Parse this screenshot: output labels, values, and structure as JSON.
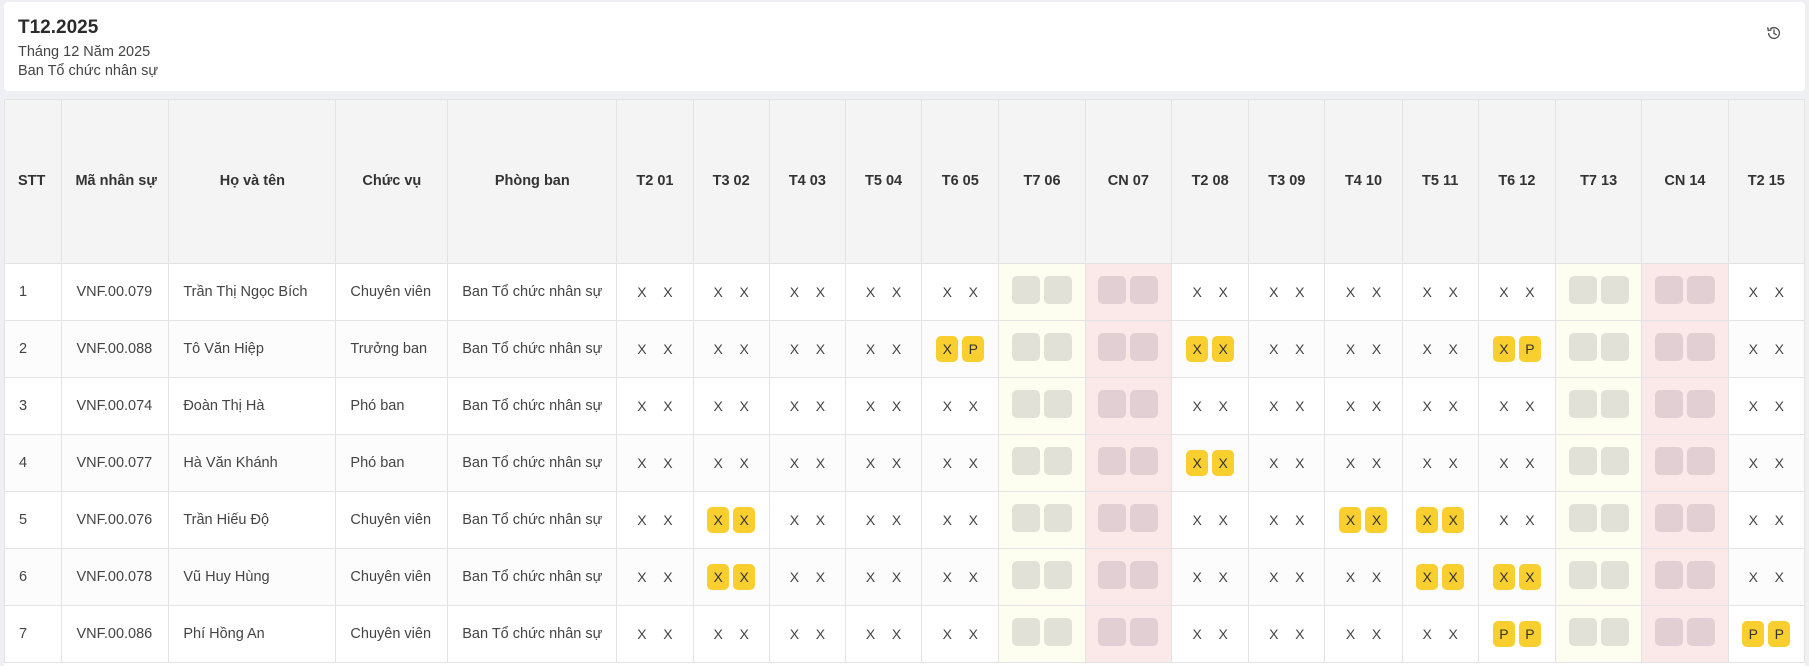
{
  "header": {
    "title": "T12.2025",
    "subtitle": "Tháng 12 Năm 2025",
    "department": "Ban Tổ chức nhân sự",
    "history_icon": "history-icon"
  },
  "columns": {
    "stt": "STT",
    "code": "Mã nhân sự",
    "name": "Họ và tên",
    "position": "Chức vụ",
    "dept": "Phòng ban",
    "days": [
      {
        "label": "T2 01",
        "type": "work"
      },
      {
        "label": "T3 02",
        "type": "work"
      },
      {
        "label": "T4 03",
        "type": "work"
      },
      {
        "label": "T5 04",
        "type": "work"
      },
      {
        "label": "T6 05",
        "type": "work"
      },
      {
        "label": "T7 06",
        "type": "sat"
      },
      {
        "label": "CN 07",
        "type": "sun"
      },
      {
        "label": "T2 08",
        "type": "work"
      },
      {
        "label": "T3 09",
        "type": "work"
      },
      {
        "label": "T4 10",
        "type": "work"
      },
      {
        "label": "T5 11",
        "type": "work"
      },
      {
        "label": "T6 12",
        "type": "work"
      },
      {
        "label": "T7 13",
        "type": "sat"
      },
      {
        "label": "CN 14",
        "type": "sun"
      },
      {
        "label": "T2 15",
        "type": "work"
      }
    ]
  },
  "rows": [
    {
      "stt": "1",
      "code": "VNF.00.079",
      "name": "Trần Thị Ngọc Bích",
      "position": "Chuyên viên",
      "dept": "Ban Tổ chức nhân sự",
      "days": [
        [
          "X",
          "X"
        ],
        [
          "X",
          "X"
        ],
        [
          "X",
          "X"
        ],
        [
          "X",
          "X"
        ],
        [
          "X",
          "X"
        ],
        [
          "",
          ""
        ],
        [
          "",
          ""
        ],
        [
          "X",
          "X"
        ],
        [
          "X",
          "X"
        ],
        [
          "X",
          "X"
        ],
        [
          "X",
          "X"
        ],
        [
          "X",
          "X"
        ],
        [
          "",
          ""
        ],
        [
          "",
          ""
        ],
        [
          "X",
          "X"
        ]
      ],
      "hl": []
    },
    {
      "stt": "2",
      "code": "VNF.00.088",
      "name": "Tô Văn Hiệp",
      "position": "Trưởng ban",
      "dept": "Ban Tổ chức nhân sự",
      "days": [
        [
          "X",
          "X"
        ],
        [
          "X",
          "X"
        ],
        [
          "X",
          "X"
        ],
        [
          "X",
          "X"
        ],
        [
          "X",
          "P"
        ],
        [
          "",
          ""
        ],
        [
          "",
          ""
        ],
        [
          "X",
          "X"
        ],
        [
          "X",
          "X"
        ],
        [
          "X",
          "X"
        ],
        [
          "X",
          "X"
        ],
        [
          "X",
          "P"
        ],
        [
          "",
          ""
        ],
        [
          "",
          ""
        ],
        [
          "X",
          "X"
        ]
      ],
      "hl": [
        4,
        7,
        11
      ]
    },
    {
      "stt": "3",
      "code": "VNF.00.074",
      "name": "Đoàn Thị Hà",
      "position": "Phó ban",
      "dept": "Ban Tổ chức nhân sự",
      "days": [
        [
          "X",
          "X"
        ],
        [
          "X",
          "X"
        ],
        [
          "X",
          "X"
        ],
        [
          "X",
          "X"
        ],
        [
          "X",
          "X"
        ],
        [
          "",
          ""
        ],
        [
          "",
          ""
        ],
        [
          "X",
          "X"
        ],
        [
          "X",
          "X"
        ],
        [
          "X",
          "X"
        ],
        [
          "X",
          "X"
        ],
        [
          "X",
          "X"
        ],
        [
          "",
          ""
        ],
        [
          "",
          ""
        ],
        [
          "X",
          "X"
        ]
      ],
      "hl": []
    },
    {
      "stt": "4",
      "code": "VNF.00.077",
      "name": "Hà Văn Khánh",
      "position": "Phó ban",
      "dept": "Ban Tổ chức nhân sự",
      "days": [
        [
          "X",
          "X"
        ],
        [
          "X",
          "X"
        ],
        [
          "X",
          "X"
        ],
        [
          "X",
          "X"
        ],
        [
          "X",
          "X"
        ],
        [
          "",
          ""
        ],
        [
          "",
          ""
        ],
        [
          "X",
          "X"
        ],
        [
          "X",
          "X"
        ],
        [
          "X",
          "X"
        ],
        [
          "X",
          "X"
        ],
        [
          "X",
          "X"
        ],
        [
          "",
          ""
        ],
        [
          "",
          ""
        ],
        [
          "X",
          "X"
        ]
      ],
      "hl": [
        7
      ]
    },
    {
      "stt": "5",
      "code": "VNF.00.076",
      "name": "Trần Hiếu Độ",
      "position": "Chuyên viên",
      "dept": "Ban Tổ chức nhân sự",
      "days": [
        [
          "X",
          "X"
        ],
        [
          "X",
          "X"
        ],
        [
          "X",
          "X"
        ],
        [
          "X",
          "X"
        ],
        [
          "X",
          "X"
        ],
        [
          "",
          ""
        ],
        [
          "",
          ""
        ],
        [
          "X",
          "X"
        ],
        [
          "X",
          "X"
        ],
        [
          "X",
          "X"
        ],
        [
          "X",
          "X"
        ],
        [
          "X",
          "X"
        ],
        [
          "",
          ""
        ],
        [
          "",
          ""
        ],
        [
          "X",
          "X"
        ]
      ],
      "hl": [
        1,
        9,
        10
      ]
    },
    {
      "stt": "6",
      "code": "VNF.00.078",
      "name": "Vũ Huy Hùng",
      "position": "Chuyên viên",
      "dept": "Ban Tổ chức nhân sự",
      "days": [
        [
          "X",
          "X"
        ],
        [
          "X",
          "X"
        ],
        [
          "X",
          "X"
        ],
        [
          "X",
          "X"
        ],
        [
          "X",
          "X"
        ],
        [
          "",
          ""
        ],
        [
          "",
          ""
        ],
        [
          "X",
          "X"
        ],
        [
          "X",
          "X"
        ],
        [
          "X",
          "X"
        ],
        [
          "X",
          "X"
        ],
        [
          "X",
          "X"
        ],
        [
          "",
          ""
        ],
        [
          "",
          ""
        ],
        [
          "X",
          "X"
        ]
      ],
      "hl": [
        1,
        10,
        11
      ]
    },
    {
      "stt": "7",
      "code": "VNF.00.086",
      "name": "Phí Hồng An",
      "position": "Chuyên viên",
      "dept": "Ban Tổ chức nhân sự",
      "days": [
        [
          "X",
          "X"
        ],
        [
          "X",
          "X"
        ],
        [
          "X",
          "X"
        ],
        [
          "X",
          "X"
        ],
        [
          "X",
          "X"
        ],
        [
          "",
          ""
        ],
        [
          "",
          ""
        ],
        [
          "X",
          "X"
        ],
        [
          "X",
          "X"
        ],
        [
          "X",
          "X"
        ],
        [
          "X",
          "X"
        ],
        [
          "P",
          "P"
        ],
        [
          "",
          ""
        ],
        [
          "",
          ""
        ],
        [
          "P",
          "P"
        ]
      ],
      "hl": [
        11,
        14
      ]
    }
  ]
}
